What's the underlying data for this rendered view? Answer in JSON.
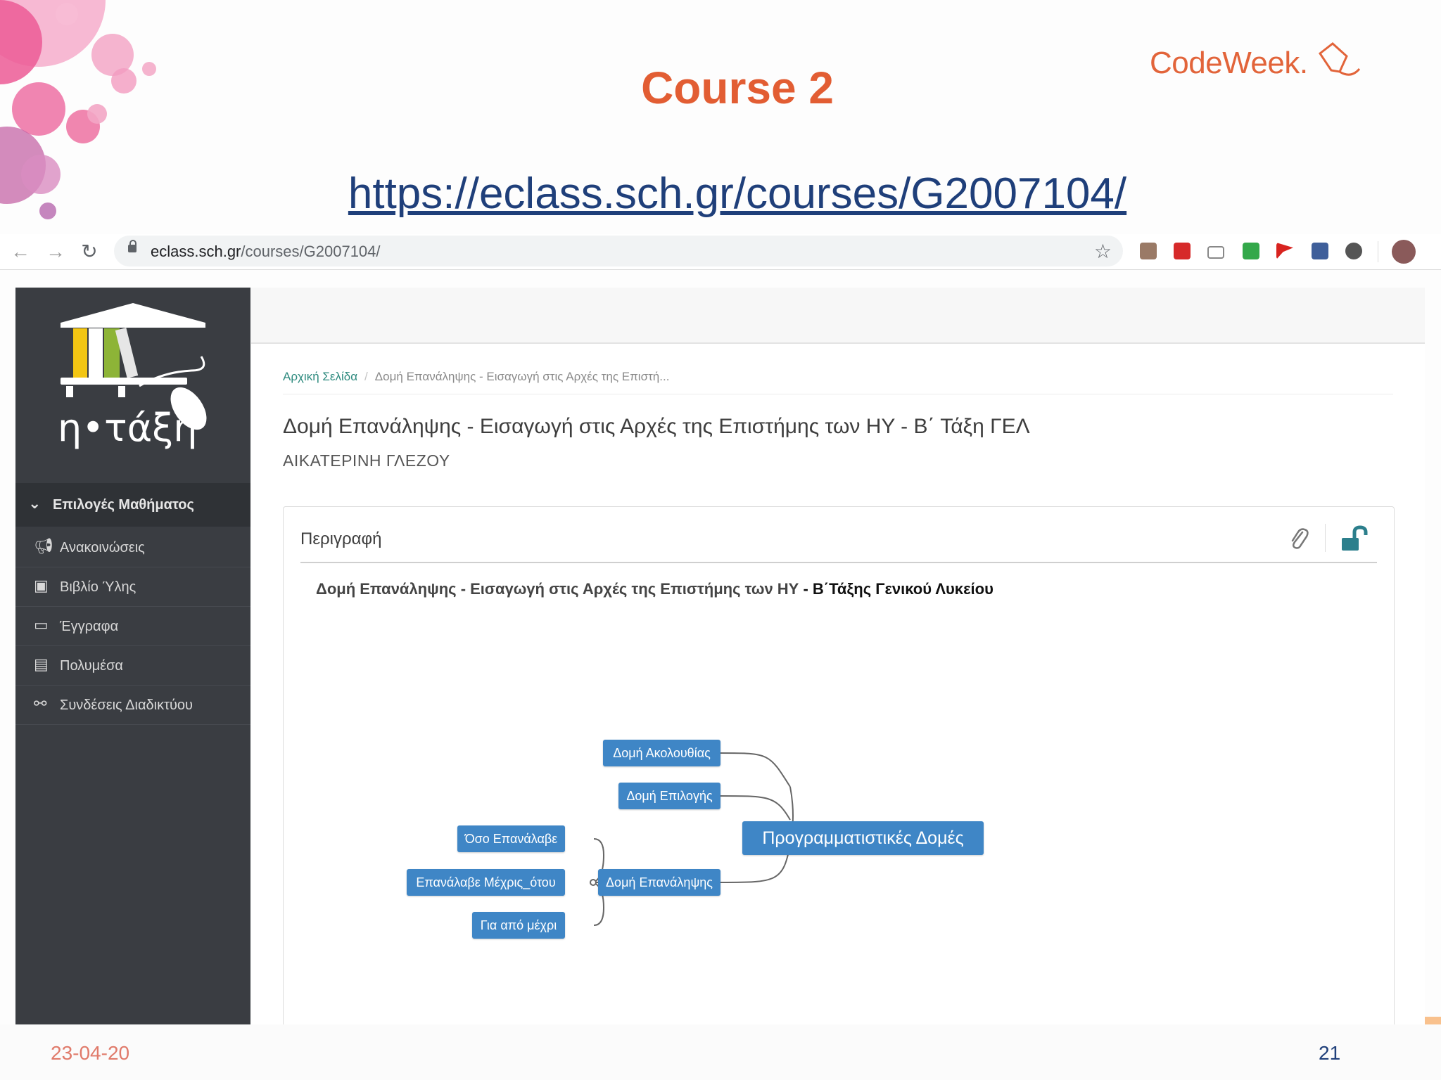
{
  "slide": {
    "title": "Course 2",
    "brand": "CodeWeek.",
    "link_text": "https://eclass.sch.gr/courses/G2007104/",
    "date": "23-04-20",
    "page_number": "21",
    "accent_color": "#e25d33"
  },
  "browser": {
    "back_icon": "arrow-left-icon",
    "forward_icon": "arrow-right-icon",
    "reload_icon": "reload-icon",
    "url_host": "eclass.sch.gr",
    "url_path": "/courses/G2007104/",
    "bookmark_icon": "star-icon",
    "extensions": [
      "pdf-icon",
      "acrobat-icon",
      "cast-icon",
      "avg-icon",
      "flag-icon",
      "puzzle-icon",
      "circle-icon"
    ]
  },
  "sidebar": {
    "logo_text": "η•τάξη",
    "menu_header": "Επιλογές Μαθήματος",
    "items": [
      {
        "label": "Ανακοινώσεις",
        "icon": "megaphone-icon"
      },
      {
        "label": "Βιβλίο Ύλης",
        "icon": "calendar-icon"
      },
      {
        "label": "Έγγραφα",
        "icon": "folder-open-icon"
      },
      {
        "label": "Πολυμέσα",
        "icon": "film-icon"
      },
      {
        "label": "Συνδέσεις Διαδικτύου",
        "icon": "link-icon"
      }
    ]
  },
  "breadcrumb": {
    "home": "Αρχική Σελίδα",
    "separator": "/",
    "current": "Δομή Επανάληψης - Εισαγωγή στις Αρχές της Επιστή..."
  },
  "course": {
    "title": "Δομή Επανάληψης - Εισαγωγή στις Αρχές της Επιστήμης των ΗΥ - Β΄ Τάξη ΓΕΛ",
    "teacher": "ΑΙΚΑΤΕΡΙΝΗ ΓΛΕΖΟΥ"
  },
  "description": {
    "title": "Περιγραφή",
    "text_main": "Δομή Επανάληψης - Εισαγωγή στις Αρχές της Επιστήμης των ΗΥ",
    "text_bold": " - Β΄Τάξης Γενικού Λυκείου",
    "attach_icon": "paperclip-icon",
    "lock_icon": "unlock-icon"
  },
  "mindmap": {
    "root": "Προγραμματιστικές Δομές",
    "branches": [
      "Δομή Ακολουθίας",
      "Δομή Επιλογής",
      "Δομή Επανάληψης"
    ],
    "loop_children": [
      "Όσο Επανάλαβε",
      "Επανάλαβε Μέχρις_ότου",
      "Για από μέχρι"
    ],
    "node_color": "#3f86c6"
  }
}
